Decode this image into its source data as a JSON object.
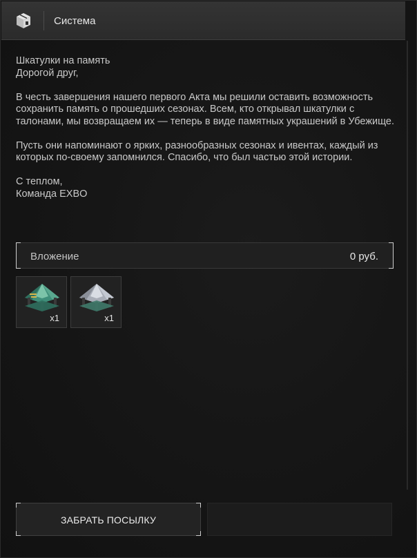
{
  "window": {
    "title": "Система",
    "icon": "mailbox-cube-icon"
  },
  "letter": {
    "subject": "Шкатулки на память",
    "greeting": "Дорогой друг,",
    "paragraph1": "В честь завершения нашего первого Акта мы решили оставить возможность сохранить память о прошедших сезонах. Всем, кто открывал шкатулки с талонами, мы возвращаем их — теперь в виде памятных украшений в Убежище.",
    "paragraph2": "Пусть они напоминают о ярких, разнообразных сезонах и ивентах, каждый из которых по-своему запомнился. Спасибо, что был частью этой истории.",
    "closing": "С теплом,",
    "signature": "Команда EXBO"
  },
  "attachment": {
    "label": "Вложение",
    "amount": "0 руб."
  },
  "items": [
    {
      "icon": "green-gazebo-icon",
      "quantity": "x1"
    },
    {
      "icon": "grey-gazebo-icon",
      "quantity": "x1"
    }
  ],
  "actions": {
    "claim_label": "ЗАБРАТЬ ПОСЫЛКУ"
  },
  "colors": {
    "background": "#161616",
    "header": "#303030",
    "text": "#c9c9c9",
    "accent_corner": "#cfcfcf"
  }
}
